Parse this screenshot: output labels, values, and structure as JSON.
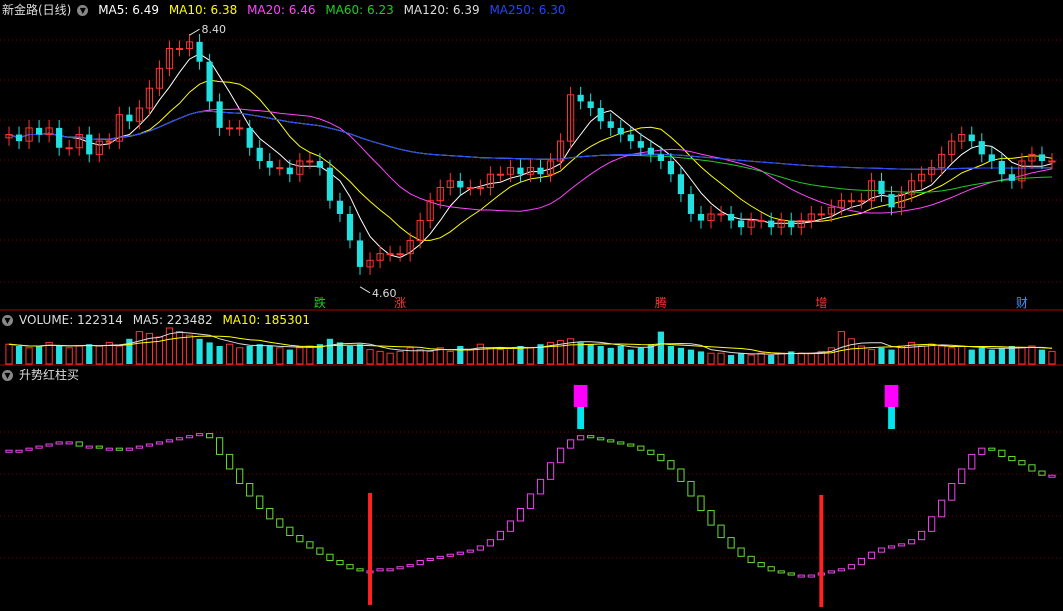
{
  "header_main": {
    "title": "新金路(日线)",
    "items": [
      {
        "label": "MA5: 6.49",
        "color": "#ffffff"
      },
      {
        "label": "MA10: 6.38",
        "color": "#ffff00"
      },
      {
        "label": "MA20: 6.46",
        "color": "#ff44ff"
      },
      {
        "label": "MA60: 6.23",
        "color": "#22cc22"
      },
      {
        "label": "MA120: 6.39",
        "color": "#dddddd"
      },
      {
        "label": "MA250: 6.30",
        "color": "#2244ff"
      }
    ]
  },
  "header_volume": {
    "items": [
      {
        "label": "VOLUME: 122314",
        "color": "#dddddd"
      },
      {
        "label": "MA5: 223482",
        "color": "#dddddd"
      },
      {
        "label": "MA10: 185301",
        "color": "#ffff00"
      }
    ]
  },
  "header_indicator": {
    "title": "升势红柱买"
  },
  "annotations": {
    "high": "8.40",
    "low": "4.60"
  },
  "event_markers": [
    {
      "label": "跌",
      "color": "#22cc22"
    },
    {
      "label": "涨",
      "color": "#ff3333"
    },
    {
      "label": "腾",
      "color": "#ff3333"
    },
    {
      "label": "增",
      "color": "#ff3333"
    },
    {
      "label": "财",
      "color": "#3399ff"
    }
  ],
  "colors": {
    "up": "#ff3333",
    "down": "#22e0e0",
    "grid": "#7a0000",
    "ind_up": "#ee44ee",
    "ind_down": "#66dd33",
    "buy": "#ff2222",
    "magenta_bar": "#ff00ff",
    "cyan_bar": "#00e5ee"
  },
  "chart_data": [
    {
      "type": "candlestick",
      "title": "新金路(日线)",
      "x": "daily (dates not shown)",
      "high": 8.4,
      "low": 4.6,
      "close_series": [
        6.9,
        6.8,
        7.0,
        6.9,
        7.0,
        6.7,
        6.7,
        6.9,
        6.6,
        6.8,
        6.8,
        7.2,
        7.1,
        7.3,
        7.6,
        7.9,
        8.2,
        8.2,
        8.3,
        8.0,
        7.4,
        7.0,
        7.0,
        7.0,
        6.7,
        6.5,
        6.4,
        6.4,
        6.3,
        6.5,
        6.5,
        6.4,
        5.9,
        5.7,
        5.3,
        4.9,
        5.0,
        5.1,
        5.1,
        5.1,
        5.3,
        5.6,
        5.9,
        6.1,
        6.2,
        6.1,
        6.1,
        6.1,
        6.3,
        6.3,
        6.4,
        6.3,
        6.4,
        6.3,
        6.5,
        6.8,
        7.5,
        7.4,
        7.3,
        7.1,
        7.0,
        6.9,
        6.8,
        6.7,
        6.6,
        6.5,
        6.3,
        6.0,
        5.7,
        5.6,
        5.7,
        5.7,
        5.6,
        5.5,
        5.6,
        5.6,
        5.5,
        5.6,
        5.5,
        5.6,
        5.7,
        5.7,
        5.8,
        5.9,
        5.9,
        5.9,
        6.2,
        6.0,
        5.8,
        6.0,
        6.2,
        6.3,
        6.4,
        6.6,
        6.8,
        6.9,
        6.8,
        6.6,
        6.5,
        6.3,
        6.2,
        6.5,
        6.6,
        6.5,
        6.5
      ],
      "legend": [
        "MA5: 6.49",
        "MA10: 6.38",
        "MA20: 6.46",
        "MA60: 6.23",
        "MA120: 6.39",
        "MA250: 6.30"
      ]
    },
    {
      "type": "bar",
      "title": "VOLUME",
      "values_relative": [
        0.55,
        0.5,
        0.45,
        0.5,
        0.6,
        0.5,
        0.45,
        0.5,
        0.55,
        0.5,
        0.6,
        0.5,
        0.7,
        0.9,
        0.85,
        0.75,
        1.0,
        0.9,
        0.8,
        0.7,
        0.6,
        0.5,
        0.55,
        0.45,
        0.5,
        0.55,
        0.5,
        0.45,
        0.4,
        0.45,
        0.5,
        0.55,
        0.7,
        0.6,
        0.5,
        0.55,
        0.4,
        0.35,
        0.3,
        0.35,
        0.45,
        0.4,
        0.35,
        0.45,
        0.35,
        0.5,
        0.4,
        0.55,
        0.45,
        0.4,
        0.45,
        0.5,
        0.45,
        0.55,
        0.6,
        0.65,
        0.7,
        0.6,
        0.55,
        0.5,
        0.45,
        0.5,
        0.4,
        0.45,
        0.55,
        0.9,
        0.5,
        0.45,
        0.4,
        0.35,
        0.3,
        0.3,
        0.25,
        0.3,
        0.25,
        0.3,
        0.25,
        0.3,
        0.35,
        0.3,
        0.3,
        0.35,
        0.45,
        0.9,
        0.7,
        0.5,
        0.4,
        0.45,
        0.4,
        0.5,
        0.6,
        0.5,
        0.55,
        0.5,
        0.45,
        0.5,
        0.4,
        0.45,
        0.4,
        0.45,
        0.5,
        0.45,
        0.5,
        0.4,
        0.35
      ],
      "legend": [
        "VOLUME: 122314",
        "MA5: 223482",
        "MA10: 185301"
      ]
    },
    {
      "type": "bar",
      "title": "升势红柱买",
      "indicator_values": [
        0.72,
        0.72,
        0.73,
        0.74,
        0.75,
        0.76,
        0.76,
        0.74,
        0.74,
        0.73,
        0.73,
        0.72,
        0.73,
        0.74,
        0.75,
        0.76,
        0.77,
        0.78,
        0.79,
        0.8,
        0.78,
        0.7,
        0.63,
        0.56,
        0.5,
        0.44,
        0.39,
        0.35,
        0.31,
        0.28,
        0.25,
        0.22,
        0.19,
        0.17,
        0.15,
        0.14,
        0.14,
        0.15,
        0.15,
        0.16,
        0.17,
        0.19,
        0.2,
        0.21,
        0.22,
        0.23,
        0.24,
        0.26,
        0.29,
        0.33,
        0.38,
        0.44,
        0.51,
        0.58,
        0.66,
        0.73,
        0.77,
        0.79,
        0.78,
        0.77,
        0.76,
        0.75,
        0.74,
        0.72,
        0.7,
        0.67,
        0.63,
        0.57,
        0.5,
        0.43,
        0.36,
        0.3,
        0.25,
        0.21,
        0.18,
        0.16,
        0.14,
        0.13,
        0.12,
        0.12,
        0.12,
        0.13,
        0.14,
        0.15,
        0.17,
        0.2,
        0.23,
        0.25,
        0.26,
        0.27,
        0.29,
        0.33,
        0.4,
        0.48,
        0.56,
        0.63,
        0.7,
        0.73,
        0.72,
        0.69,
        0.67,
        0.65,
        0.62,
        0.6,
        0.6
      ],
      "buy_signals_at": [
        36,
        81
      ],
      "marker_bars_at": [
        57,
        88
      ]
    }
  ]
}
